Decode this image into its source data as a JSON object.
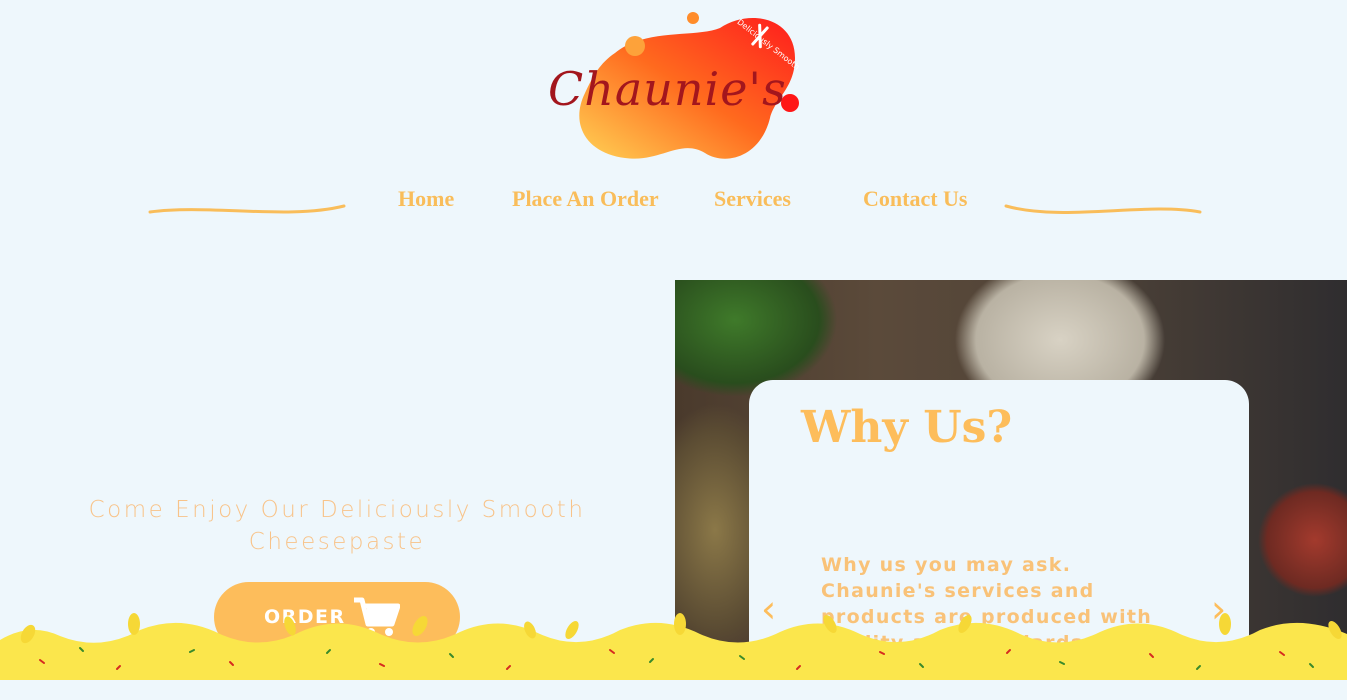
{
  "logo": {
    "text": "Chaunie's",
    "tagline": "Deliciously Smooth"
  },
  "nav": {
    "items": [
      {
        "label": "Home"
      },
      {
        "label": "Place An Order"
      },
      {
        "label": "Services"
      },
      {
        "label": "Contact Us"
      }
    ]
  },
  "hero": {
    "tagline": "Come Enjoy Our Deliciously Smooth Cheesepaste",
    "order_label": "ORDER"
  },
  "why_card": {
    "title": "Why Us?",
    "body": "Why us you may ask. Chaunie's services and products are produced with quality and standards that"
  },
  "colors": {
    "accent": "#fdbd5b",
    "background": "#eef7fc",
    "logo_red": "#a3161d"
  }
}
